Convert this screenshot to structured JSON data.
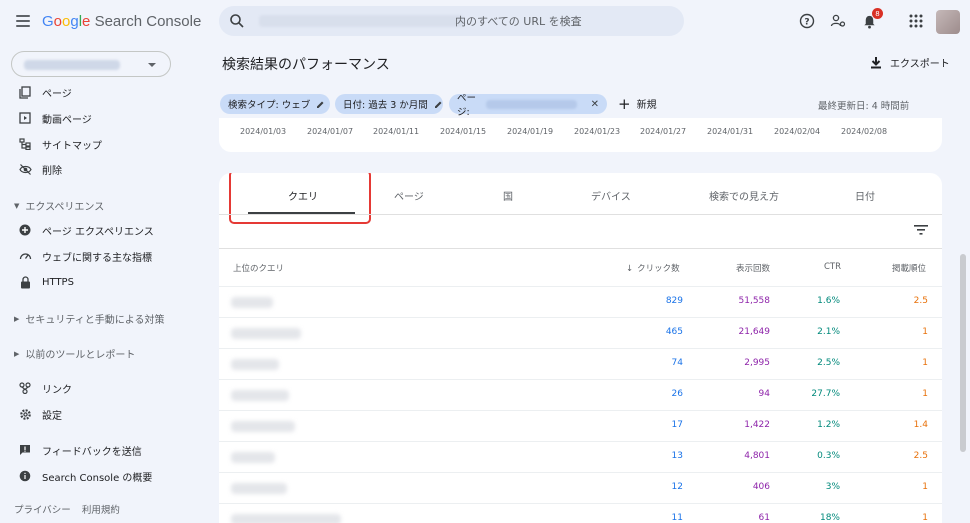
{
  "header": {
    "logo_google": [
      "G",
      "o",
      "o",
      "g",
      "l",
      "e"
    ],
    "logo_product": "Search Console",
    "search_suffix": "内のすべての URL を検査",
    "notification_count": "8"
  },
  "sidebar": {
    "items_top": [
      {
        "label": "ページ",
        "icon": "pages-icon"
      },
      {
        "label": "動画ページ",
        "icon": "video-pages-icon"
      },
      {
        "label": "サイトマップ",
        "icon": "sitemap-icon"
      },
      {
        "label": "削除",
        "icon": "removals-icon"
      }
    ],
    "section_experience": "エクスペリエンス",
    "items_experience": [
      {
        "label": "ページ エクスペリエンス",
        "icon": "page-experience-icon"
      },
      {
        "label": "ウェブに関する主な指標",
        "icon": "core-web-vitals-icon"
      },
      {
        "label": "HTTPS",
        "icon": "lock-icon"
      }
    ],
    "section_security": "セキュリティと手動による対策",
    "section_legacy": "以前のツールとレポート",
    "items_bottom": [
      {
        "label": "リンク",
        "icon": "links-icon"
      },
      {
        "label": "設定",
        "icon": "settings-icon"
      }
    ],
    "items_footer": [
      {
        "label": "フィードバックを送信",
        "icon": "feedback-icon"
      },
      {
        "label": "Search Console の概要",
        "icon": "info-icon"
      }
    ],
    "privacy": "プライバシー",
    "terms": "利用規約"
  },
  "main": {
    "title": "検索結果のパフォーマンス",
    "export_label": "エクスポート",
    "filters": {
      "search_type": "検索タイプ: ウェブ",
      "date": "日付: 過去 3 か月間",
      "page": "ページ:"
    },
    "new_label": "新規",
    "last_updated": "最終更新日: 4 時間前",
    "chart_dates": [
      "2024/01/03",
      "2024/01/07",
      "2024/01/11",
      "2024/01/15",
      "2024/01/19",
      "2024/01/23",
      "2024/01/27",
      "2024/01/31",
      "2024/02/04",
      "2024/02/08"
    ],
    "tabs": [
      "クエリ",
      "ページ",
      "国",
      "デバイス",
      "検索での見え方",
      "日付"
    ],
    "table": {
      "col_query": "上位のクエリ",
      "col_clicks": "クリック数",
      "col_impressions": "表示回数",
      "col_ctr": "CTR",
      "col_position": "掲載順位",
      "rows": [
        {
          "clicks": "829",
          "impressions": "51,558",
          "ctr": "1.6%",
          "position": "2.5"
        },
        {
          "clicks": "465",
          "impressions": "21,649",
          "ctr": "2.1%",
          "position": "1"
        },
        {
          "clicks": "74",
          "impressions": "2,995",
          "ctr": "2.5%",
          "position": "1"
        },
        {
          "clicks": "26",
          "impressions": "94",
          "ctr": "27.7%",
          "position": "1"
        },
        {
          "clicks": "17",
          "impressions": "1,422",
          "ctr": "1.2%",
          "position": "1.4"
        },
        {
          "clicks": "13",
          "impressions": "4,801",
          "ctr": "0.3%",
          "position": "2.5"
        },
        {
          "clicks": "12",
          "impressions": "406",
          "ctr": "3%",
          "position": "1"
        },
        {
          "clicks": "11",
          "impressions": "61",
          "ctr": "18%",
          "position": "1"
        }
      ]
    }
  },
  "colors": {
    "clicks": "#1a73e8",
    "impressions": "#8e24aa",
    "ctr": "#00897b",
    "position": "#e8710a",
    "highlight": "#e53935",
    "chip": "#c9dbf7"
  }
}
